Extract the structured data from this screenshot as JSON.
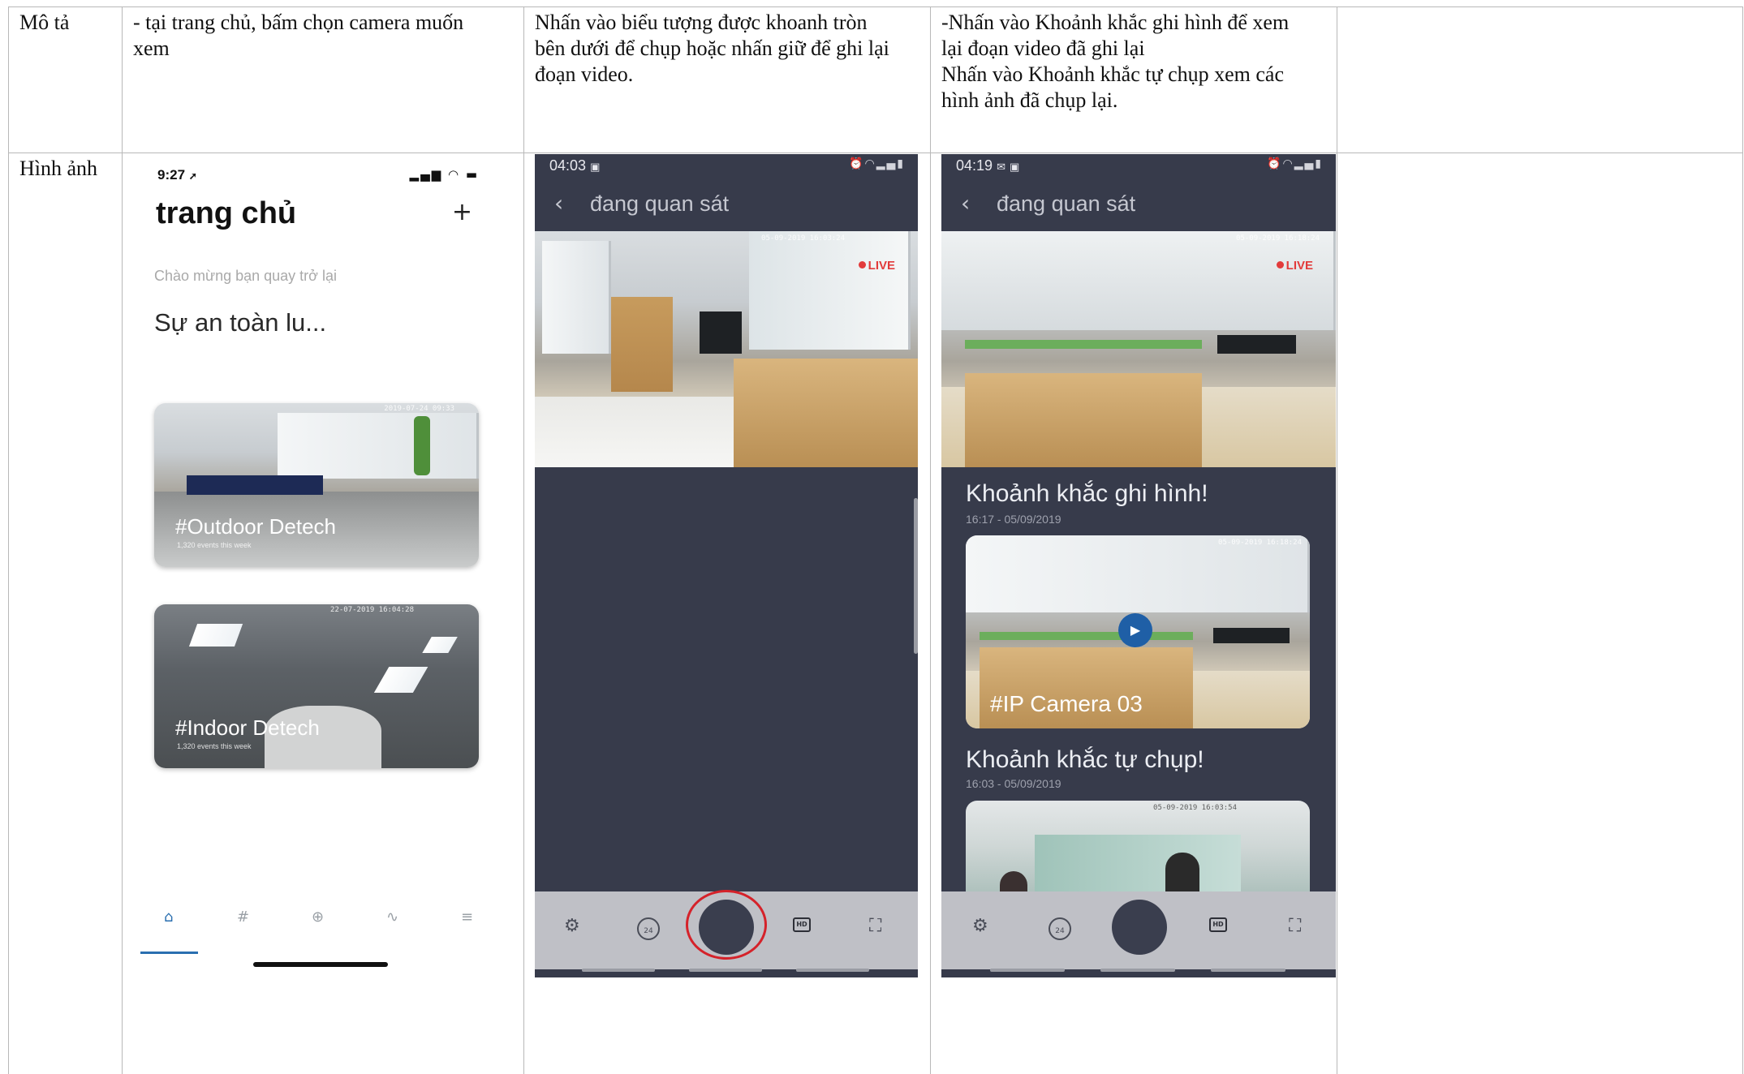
{
  "table": {
    "row1_label": "Mô tả",
    "row2_label": "Hình ảnh",
    "descriptions": [
      "- tại trang chủ, bấm chọn camera muốn\nxem",
      "Nhấn vào biểu tượng được khoanh tròn\nbên dưới để chụp hoặc nhấn giữ để ghi lại\nđoạn video.",
      "-Nhấn vào Khoảnh khắc ghi hình để xem\nlại đoạn video đã ghi lại\nNhấn vào Khoảnh khắc tự chụp xem các\nhình ảnh đã chụp lại."
    ]
  },
  "phone_home": {
    "time": "9:27",
    "title": "trang chủ",
    "add_label": "+",
    "welcome": "Chào mừng bạn quay trở lại",
    "heading": "Sự an toàn lu...",
    "cards": [
      {
        "title": "#Outdoor Detech",
        "subtitle": "1,320 events this week"
      },
      {
        "title": "#Indoor Detech",
        "subtitle": "1,320 events this week"
      }
    ],
    "nav_icons": [
      "home-icon",
      "hash-icon",
      "crosshair-icon",
      "activity-icon",
      "menu-icon"
    ],
    "active_nav": "home-icon",
    "accent_color": "#2a6fb0"
  },
  "phone_live": {
    "time": "04:03",
    "title": "đang quan sát",
    "live_label": "LIVE",
    "toolbar_icons": [
      "gear-icon",
      "history-24-icon",
      "shutter-button",
      "hd-icon",
      "fullscreen-icon"
    ],
    "hd_label": "HD",
    "history_label": "24",
    "highlight_color": "#d5222a"
  },
  "phone_moments": {
    "time": "04:19",
    "title": "đang quan sát",
    "live_label": "LIVE",
    "recorded_section": "Khoảnh khắc ghi hình!",
    "recorded_date": "16:17 - 05/09/2019",
    "recorded_clip_title": "#IP Camera 03",
    "snapshot_section": "Khoảnh khắc tự chụp!",
    "snapshot_date": "16:03 - 05/09/2019",
    "hd_label": "HD",
    "history_label": "24"
  }
}
